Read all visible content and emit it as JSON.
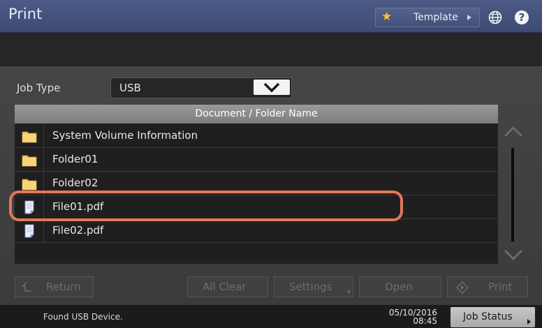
{
  "header": {
    "title": "Print",
    "template_label": "Template",
    "help_glyph": "?"
  },
  "job_type": {
    "label": "Job Type",
    "value": "USB"
  },
  "list": {
    "column_header": "Document / Folder Name",
    "items": [
      {
        "name": "System Volume Information",
        "kind": "folder"
      },
      {
        "name": "Folder01",
        "kind": "folder"
      },
      {
        "name": "Folder02",
        "kind": "folder"
      },
      {
        "name": "File01.pdf",
        "kind": "file",
        "highlighted": true
      },
      {
        "name": "File02.pdf",
        "kind": "file"
      }
    ]
  },
  "buttons": {
    "return": "Return",
    "all_clear": "All Clear",
    "settings": "Settings",
    "open": "Open",
    "print": "Print"
  },
  "status": {
    "message": "Found USB Device.",
    "date": "05/10/2016",
    "time": "08:45",
    "job_status": "Job Status"
  },
  "colors": {
    "accent_highlight": "#e2775c",
    "title_bar": "#44507a",
    "folder_icon": "#f4c65a"
  }
}
